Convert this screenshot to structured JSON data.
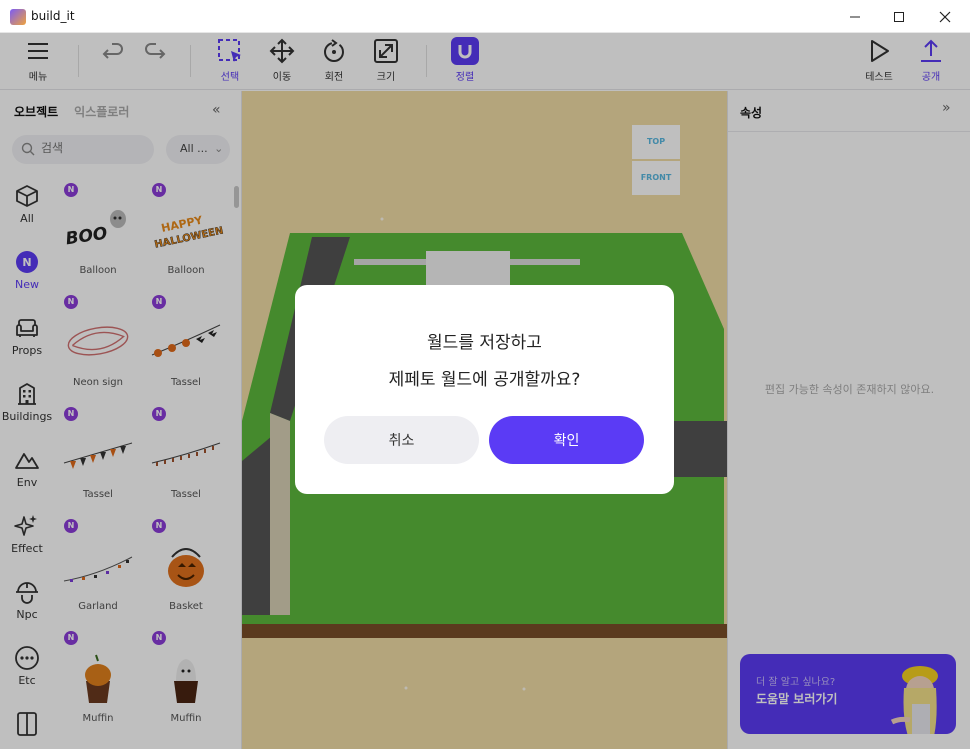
{
  "window": {
    "title": "build_it"
  },
  "toolbar": {
    "menu": "메뉴",
    "select": "선택",
    "move": "이동",
    "rotate": "회전",
    "scale": "크기",
    "align": "정렬",
    "test": "테스트",
    "publish": "공개"
  },
  "left_panel": {
    "tab_objects": "오브젝트",
    "tab_explorer": "익스플로러",
    "search_placeholder": "검색",
    "filter_value": "All ...",
    "categories": [
      "All",
      "New",
      "Props",
      "Buildings",
      "Env",
      "Effect",
      "Npc",
      "Etc"
    ],
    "new_badge": "N",
    "items": [
      "Balloon",
      "Balloon",
      "Neon sign",
      "Tassel",
      "Tassel",
      "Tassel",
      "Garland",
      "Basket",
      "Muffin",
      "Muffin"
    ],
    "thumb_text": {
      "boo": "BOO",
      "happy": "HAPPY",
      "halloween": "HALLOWEEN"
    }
  },
  "viewport": {
    "gizmo_top": "TOP",
    "gizmo_front": "FRONT"
  },
  "right_panel": {
    "title": "속성",
    "empty_message": "편집 가능한 속성이 존재하지 않아요.",
    "help_subtitle": "더 잘 알고 싶나요?",
    "help_link": "도움말 보러가기"
  },
  "dialog": {
    "line1": "월드를 저장하고",
    "line2": "제페토 월드에 공개할까요?",
    "cancel": "취소",
    "confirm": "확인"
  },
  "colors": {
    "accent": "#5b3bf5",
    "new_badge": "#8b3dd9",
    "ground_sand": "#f0dca6",
    "grass": "#5cb83c"
  }
}
